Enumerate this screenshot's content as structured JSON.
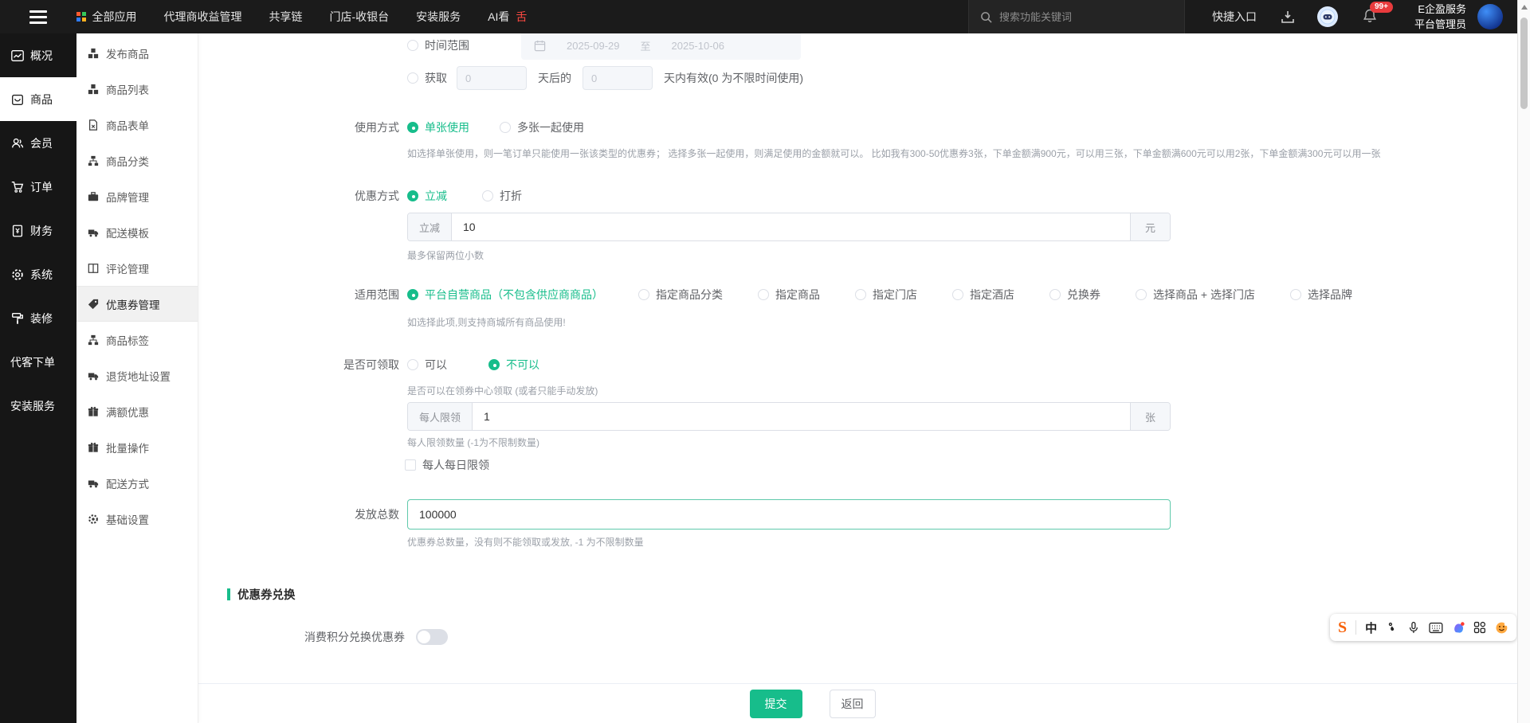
{
  "topbar": {
    "apps_label": "全部应用",
    "menu": [
      "代理商收益管理",
      "共享链",
      "门店-收银台",
      "安装服务"
    ],
    "ai": {
      "prefix": "AI看",
      "suffix": "舌"
    },
    "search_placeholder": "搜索功能关键词",
    "quick_entry": "快捷入口",
    "notification_badge": "99+",
    "account_line1": "E企盈服务",
    "account_line2": "平台管理员"
  },
  "sidebar_primary": {
    "items": [
      {
        "label": "概况"
      },
      {
        "label": "商品"
      },
      {
        "label": "会员"
      },
      {
        "label": "订单"
      },
      {
        "label": "财务"
      },
      {
        "label": "系统"
      },
      {
        "label": "装修"
      },
      {
        "label": "代客下单"
      },
      {
        "label": "安装服务"
      }
    ]
  },
  "sidebar_secondary": {
    "items": [
      {
        "label": "发布商品"
      },
      {
        "label": "商品列表"
      },
      {
        "label": "商品表单"
      },
      {
        "label": "商品分类"
      },
      {
        "label": "品牌管理"
      },
      {
        "label": "配送模板"
      },
      {
        "label": "评论管理"
      },
      {
        "label": "优惠券管理"
      },
      {
        "label": "商品标签"
      },
      {
        "label": "退货地址设置"
      },
      {
        "label": "满额优惠"
      },
      {
        "label": "批量操作"
      },
      {
        "label": "配送方式"
      },
      {
        "label": "基础设置"
      }
    ]
  },
  "form": {
    "validity": {
      "range_label": "时间范围",
      "range_start": "2025-09-29",
      "range_separator": "至",
      "range_end": "2025-10-06",
      "acquire_label": "获取",
      "acquire_placeholder1": "0",
      "acquire_middle": "天后的",
      "acquire_placeholder2": "0",
      "acquire_suffix": "天内有效(0 为不限时间使用)"
    },
    "usage": {
      "label": "使用方式",
      "option1": "单张使用",
      "option2": "多张一起使用",
      "help": "如选择单张使用，则一笔订单只能使用一张该类型的优惠券； 选择多张一起使用，则满足使用的金额就可以。 比如我有300-50优惠券3张，下单金额满900元，可以用三张，下单金额满600元可以用2张，下单金额满300元可以用一张"
    },
    "discount": {
      "label": "优惠方式",
      "option1": "立减",
      "option2": "打折",
      "input_prefix": "立减",
      "input_value": "10",
      "input_suffix": "元",
      "note": "最多保留两位小数"
    },
    "scope": {
      "label": "适用范围",
      "option1": "平台自营商品（不包含供应商商品）",
      "option2": "指定商品分类",
      "option3": "指定商品",
      "option4": "指定门店",
      "option5": "指定酒店",
      "option6": "兑换券",
      "option7": "选择商品 + 选择门店",
      "option8": "选择品牌",
      "note": "如选择此项,则支持商城所有商品使用!"
    },
    "receivable": {
      "label": "是否可领取",
      "option1": "可以",
      "option2": "不可以",
      "note": "是否可以在领券中心领取 (或者只能手动发放)",
      "limit_prefix": "每人限领",
      "limit_value": "1",
      "limit_suffix": "张",
      "limit_note": "每人限领数量 (-1为不限制数量)",
      "daily_checkbox_label": "每人每日限领"
    },
    "total": {
      "label": "发放总数",
      "value": "100000",
      "note": "优惠券总数量，没有则不能领取或发放, -1 为不限制数量"
    },
    "exchange": {
      "section_title": "优惠券兑换",
      "toggle_label": "消费积分兑换优惠券"
    }
  },
  "footer": {
    "submit": "提交",
    "back": "返回"
  },
  "ime": {
    "logo": "S",
    "lang": "中"
  },
  "colors": {
    "accent": "#17bd8b",
    "danger": "#f0392b",
    "badge": "#e93b3d"
  }
}
